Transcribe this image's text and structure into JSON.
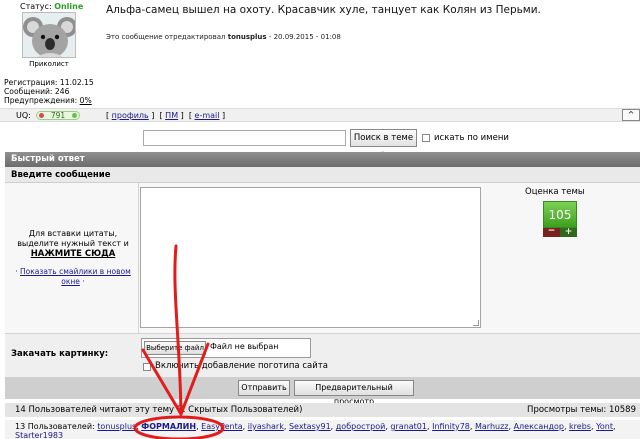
{
  "post": {
    "status_label": "Статус:",
    "status_value": "Online",
    "rank": "Приколист",
    "reg_label": "Регистрация:",
    "reg_value": "11.02.15",
    "posts_label": "Сообщений:",
    "posts_value": "246",
    "warn_label": "Предупреждения:",
    "warn_value": "0%",
    "text": "Альфа-самец вышел на охоту. Красавчик хуле, танцует как Колян из Перьми.",
    "edit_prefix": "Это сообщение отредактировал",
    "edit_user": "tonusplus",
    "edit_suffix": "- 20.09.2015 - 01:08"
  },
  "post_bar": {
    "uq_label": "UQ:",
    "uq_value": "791",
    "link_profile": "профиль",
    "link_pm": "ПМ",
    "link_email": "e-mail",
    "up_glyph": "^"
  },
  "search": {
    "button": "Поиск в теме »",
    "by_name": "искать по имени"
  },
  "quick_reply": {
    "title": "Быстрый ответ",
    "enter_message": "Введите сообщение",
    "help_line1": "Для вставки цитаты,",
    "help_line2": "выделите нужный текст и",
    "help_click": "НАЖМИТЕ СЮДА",
    "smiles_link": "Показать смайлики в новом окне",
    "rating_label": "Оценка темы",
    "rating_value": "105",
    "minus": "−",
    "plus": "+"
  },
  "upload": {
    "label": "Закачать картинку:",
    "choose_file": "Выберите файл",
    "no_file": "Файл не выбран",
    "logo_option": "Включить добавление поготипа сайта"
  },
  "submit": {
    "send": "Отправить",
    "preview": "Предварительный просмотр"
  },
  "readers": {
    "count_text": "14 Пользователей читают эту тему (1 Скрытых Пользователей)",
    "views_text": "Просмотры темы: 10589",
    "list_label": "13 Пользователей:",
    "users": [
      "tonusplus",
      "ФОРМАЛИН",
      "EasyPenta",
      "ilyashark",
      "Sextasy91",
      "добрострой",
      "granat01",
      "Infinity78",
      "Marhuzz",
      "Александор",
      "krebs",
      "Yont",
      "Starter1983"
    ]
  },
  "colors": {
    "online": "#2e9e26",
    "header_bg": "#7a7a7a",
    "rating_green": "#5ab639",
    "annotation_red": "#e21b1b"
  }
}
